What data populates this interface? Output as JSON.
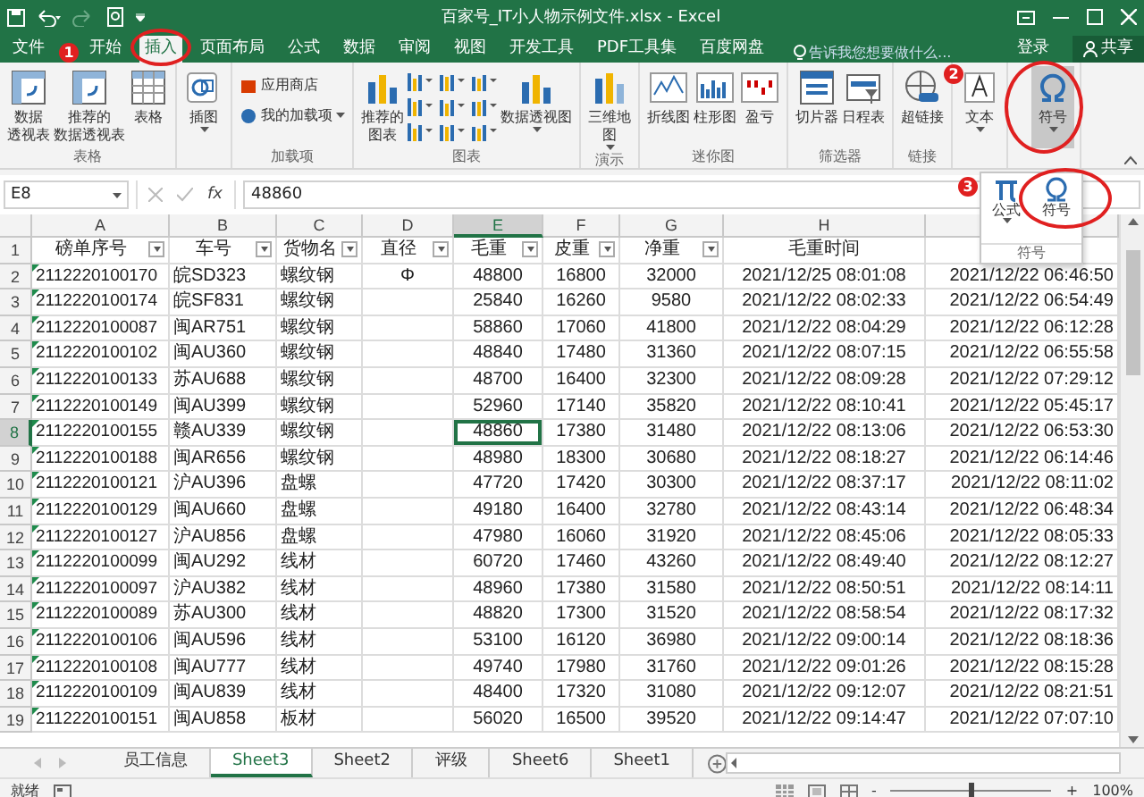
{
  "window": {
    "title": "百家号_IT小人物示例文件.xlsx - Excel"
  },
  "tabs": [
    {
      "label": "文件",
      "selected": false
    },
    {
      "label": "开始",
      "selected": false
    },
    {
      "label": "插入",
      "selected": true
    },
    {
      "label": "页面布局",
      "selected": false
    },
    {
      "label": "公式",
      "selected": false
    },
    {
      "label": "数据",
      "selected": false
    },
    {
      "label": "审阅",
      "selected": false
    },
    {
      "label": "视图",
      "selected": false
    },
    {
      "label": "开发工具",
      "selected": false
    },
    {
      "label": "PDF工具集",
      "selected": false
    },
    {
      "label": "百度网盘",
      "selected": false
    }
  ],
  "tell_me": {
    "placeholder": "告诉我您想要做什么..."
  },
  "sign_in": "登录",
  "share": "共享",
  "ribbon": {
    "groups": [
      {
        "label": "表格",
        "items": [
          {
            "kind": "large",
            "lines": [
              "数据",
              "透视表"
            ]
          },
          {
            "kind": "large",
            "lines": [
              "推荐的",
              "数据透视表"
            ]
          },
          {
            "kind": "large",
            "lines": [
              "表格"
            ]
          }
        ]
      },
      {
        "items": [
          {
            "kind": "large",
            "lines": [
              "插图"
            ],
            "dropdown": true
          }
        ]
      },
      {
        "label": "加载项",
        "items": [
          {
            "kind": "small",
            "label": "应用商店"
          },
          {
            "kind": "small",
            "label": "我的加载项",
            "dropdown": true
          }
        ]
      },
      {
        "label": "图表",
        "items": [
          {
            "kind": "large",
            "lines": [
              "推荐的",
              "图表"
            ]
          },
          {
            "kind": "chart-grid"
          },
          {
            "kind": "large",
            "lines": [
              "数据透视图"
            ],
            "dropdown": true
          }
        ]
      },
      {
        "label": "演示",
        "items": [
          {
            "kind": "large",
            "lines": [
              "三维地",
              "图"
            ],
            "dropdown": true
          }
        ]
      },
      {
        "label": "迷你图",
        "items": [
          {
            "kind": "large",
            "lines": [
              "折线图"
            ]
          },
          {
            "kind": "large",
            "lines": [
              "柱形图"
            ]
          },
          {
            "kind": "large",
            "lines": [
              "盈亏"
            ]
          }
        ]
      },
      {
        "label": "筛选器",
        "items": [
          {
            "kind": "large",
            "lines": [
              "切片器"
            ]
          },
          {
            "kind": "large",
            "lines": [
              "日程表"
            ]
          }
        ]
      },
      {
        "label": "链接",
        "items": [
          {
            "kind": "large",
            "lines": [
              "超链接"
            ]
          }
        ]
      },
      {
        "items": [
          {
            "kind": "large",
            "lines": [
              "文本"
            ],
            "dropdown": true
          }
        ]
      },
      {
        "items": [
          {
            "kind": "large",
            "lines": [
              "符号"
            ],
            "dropdown": true,
            "pressed": true
          }
        ]
      }
    ]
  },
  "symbol_menu": {
    "items": [
      {
        "label": "公式",
        "dropdown": true
      },
      {
        "label": "符号"
      }
    ],
    "group_label": "符号"
  },
  "formula_bar": {
    "name_box": "E8",
    "function_label": "fx",
    "value": "48860"
  },
  "columns": [
    {
      "letter": "A",
      "selected": false,
      "filter": true,
      "number_as_text": true
    },
    {
      "letter": "B",
      "selected": false,
      "filter": true
    },
    {
      "letter": "C",
      "selected": false,
      "filter": true
    },
    {
      "letter": "D",
      "selected": false,
      "filter": true
    },
    {
      "letter": "E",
      "selected": true,
      "filter": true
    },
    {
      "letter": "F",
      "selected": false,
      "filter": true
    },
    {
      "letter": "G",
      "selected": false,
      "filter": true
    },
    {
      "letter": "H",
      "selected": false
    },
    {
      "selected": false
    }
  ],
  "header_row": {
    "number": "1",
    "selected": false,
    "cells": [
      "磅单序号",
      "车号",
      "货物名",
      "直径",
      "毛重",
      "皮重",
      "净重",
      "毛重时间",
      ""
    ]
  },
  "rows": [
    {
      "number": "2",
      "selected": false,
      "cells": [
        "2112220100170",
        "皖SD323",
        "螺纹钢",
        "Φ",
        "48800",
        "16800",
        "32000",
        "2021/12/25 08:01:08",
        "2021/12/22 06:46:50"
      ]
    },
    {
      "number": "3",
      "selected": false,
      "cells": [
        "2112220100174",
        "皖SF831",
        "螺纹钢",
        "",
        "25840",
        "16260",
        "9580",
        "2021/12/22 08:02:33",
        "2021/12/22 06:54:49"
      ]
    },
    {
      "number": "4",
      "selected": false,
      "cells": [
        "2112220100087",
        "闽AR751",
        "螺纹钢",
        "",
        "58860",
        "17060",
        "41800",
        "2021/12/22 08:04:29",
        "2021/12/22 06:12:28"
      ]
    },
    {
      "number": "5",
      "selected": false,
      "cells": [
        "2112220100102",
        "闽AU360",
        "螺纹钢",
        "",
        "48840",
        "17480",
        "31360",
        "2021/12/22 08:07:15",
        "2021/12/22 06:55:58"
      ]
    },
    {
      "number": "6",
      "selected": false,
      "cells": [
        "2112220100133",
        "苏AU688",
        "螺纹钢",
        "",
        "48700",
        "16400",
        "32300",
        "2021/12/22 08:09:28",
        "2021/12/22 07:29:12"
      ]
    },
    {
      "number": "7",
      "selected": false,
      "cells": [
        "2112220100149",
        "闽AU399",
        "螺纹钢",
        "",
        "52960",
        "17140",
        "35820",
        "2021/12/22 08:10:41",
        "2021/12/22 05:45:17"
      ]
    },
    {
      "number": "8",
      "selected": true,
      "cells": [
        "2112220100155",
        "赣AU339",
        "螺纹钢",
        "",
        "48860",
        "17380",
        "31480",
        "2021/12/22 08:13:06",
        "2021/12/22 06:53:30"
      ]
    },
    {
      "number": "9",
      "selected": false,
      "cells": [
        "2112220100188",
        "闽AR656",
        "螺纹钢",
        "",
        "48980",
        "18300",
        "30680",
        "2021/12/22 08:18:27",
        "2021/12/22 06:14:46"
      ]
    },
    {
      "number": "10",
      "selected": false,
      "cells": [
        "2112220100121",
        "沪AU396",
        "盘螺",
        "",
        "47720",
        "17420",
        "30300",
        "2021/12/22 08:37:17",
        "2021/12/22 08:11:02"
      ]
    },
    {
      "number": "11",
      "selected": false,
      "cells": [
        "2112220100129",
        "闽AU660",
        "盘螺",
        "",
        "49180",
        "16400",
        "32780",
        "2021/12/22 08:43:14",
        "2021/12/22 06:48:34"
      ]
    },
    {
      "number": "12",
      "selected": false,
      "cells": [
        "2112220100127",
        "沪AU856",
        "盘螺",
        "",
        "47980",
        "16060",
        "31920",
        "2021/12/22 08:45:06",
        "2021/12/22 08:05:33"
      ]
    },
    {
      "number": "13",
      "selected": false,
      "cells": [
        "2112220100099",
        "闽AU292",
        "线材",
        "",
        "60720",
        "17460",
        "43260",
        "2021/12/22 08:49:40",
        "2021/12/22 08:12:27"
      ]
    },
    {
      "number": "14",
      "selected": false,
      "cells": [
        "2112220100097",
        "沪AU382",
        "线材",
        "",
        "48960",
        "17380",
        "31580",
        "2021/12/22 08:50:51",
        "2021/12/22 08:14:11"
      ]
    },
    {
      "number": "15",
      "selected": false,
      "cells": [
        "2112220100089",
        "苏AU300",
        "线材",
        "",
        "48820",
        "17300",
        "31520",
        "2021/12/22 08:58:54",
        "2021/12/22 08:17:32"
      ]
    },
    {
      "number": "16",
      "selected": false,
      "cells": [
        "2112220100106",
        "闽AU596",
        "线材",
        "",
        "53100",
        "16120",
        "36980",
        "2021/12/22 09:00:14",
        "2021/12/22 08:18:36"
      ]
    },
    {
      "number": "17",
      "selected": false,
      "cells": [
        "2112220100108",
        "闽AU777",
        "线材",
        "",
        "49740",
        "17980",
        "31760",
        "2021/12/22 09:01:26",
        "2021/12/22 08:15:28"
      ]
    },
    {
      "number": "18",
      "selected": false,
      "cells": [
        "2112220100109",
        "闽AU839",
        "线材",
        "",
        "48400",
        "17320",
        "31080",
        "2021/12/22 09:12:07",
        "2021/12/22 08:21:51"
      ]
    },
    {
      "number": "19",
      "selected": false,
      "cells": [
        "2112220100151",
        "闽AU858",
        "板材",
        "",
        "56020",
        "16500",
        "39520",
        "2021/12/22 09:14:47",
        "2021/12/22 07:07:10"
      ]
    }
  ],
  "sheet_tabs": [
    {
      "label": "员工信息",
      "selected": false
    },
    {
      "label": "Sheet3",
      "selected": true
    },
    {
      "label": "Sheet2",
      "selected": false
    },
    {
      "label": "评级",
      "selected": false
    },
    {
      "label": "Sheet6",
      "selected": false
    },
    {
      "label": "Sheet1",
      "selected": false
    }
  ],
  "status_bar": {
    "text": "就绪",
    "zoom_out": "-",
    "zoom_in": "+",
    "zoom": {
      "level": 0.5
    },
    "zoom_text": "100%"
  },
  "annotations": [
    {
      "number": "1"
    },
    {
      "number": "2"
    },
    {
      "number": "3"
    }
  ]
}
